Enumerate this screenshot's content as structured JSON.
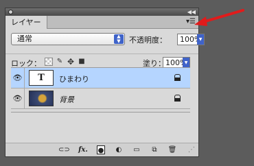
{
  "panel": {
    "tab_label": "レイヤー",
    "menu_icon": "panel-menu-icon",
    "blend_mode": "通常",
    "opacity_label": "不透明度：",
    "opacity_value": "100%",
    "lock_label": "ロック：",
    "fill_label": "塗り：",
    "fill_value": "100%"
  },
  "layers": [
    {
      "name": "ひまわり",
      "type": "text",
      "thumb_glyph": "T",
      "selected": true
    },
    {
      "name": "背景",
      "type": "image",
      "selected": false
    }
  ],
  "footer_icons": [
    "link-icon",
    "fx-icon",
    "mask-icon",
    "adjustment-icon",
    "folder-icon",
    "new-layer-icon",
    "trash-icon"
  ],
  "footer_fx_label": "fx.",
  "annotation": {
    "arrow_color": "#e11b1b"
  }
}
